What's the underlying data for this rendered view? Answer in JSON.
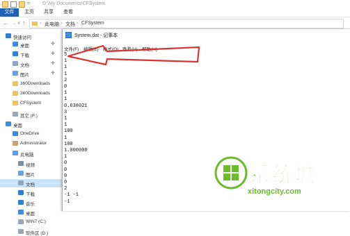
{
  "explorer": {
    "title_path": "D:\\My Documents\\CFSystem",
    "ribbon_tabs": [
      "文件",
      "主页",
      "共享",
      "查看"
    ],
    "breadcrumbs": [
      "此电脑",
      "文档",
      "CFSystem"
    ],
    "sidebar": [
      {
        "label": "快速访问",
        "icon": "star-icon",
        "color": "#2e7fd6",
        "pinned": false
      },
      {
        "label": "桌面",
        "icon": "desktop-icon",
        "color": "#3d8ee0",
        "pinned": true
      },
      {
        "label": "下载",
        "icon": "download-icon",
        "color": "#2e7fd6",
        "pinned": true
      },
      {
        "label": "文档",
        "icon": "document-icon",
        "color": "#8da6c4",
        "pinned": true
      },
      {
        "label": "图片",
        "icon": "picture-icon",
        "color": "#6ca1d8",
        "pinned": true
      },
      {
        "label": "360Downloads",
        "icon": "folder-icon",
        "color": "#f1c45a",
        "pinned": false
      },
      {
        "label": "360Downloads",
        "icon": "folder-icon",
        "color": "#f1c45a",
        "pinned": false
      },
      {
        "label": "CFSystem",
        "icon": "folder-icon",
        "color": "#f1c45a",
        "pinned": false
      },
      {
        "label": "其它 (F:)",
        "icon": "drive-icon",
        "color": "#9aa7b3",
        "pinned": false
      },
      {
        "label": "桌面",
        "icon": "desktop-icon",
        "color": "#3d8ee0",
        "pinned": false
      },
      {
        "label": "OneDrive",
        "icon": "cloud-icon",
        "color": "#3a8be0",
        "pinned": false
      },
      {
        "label": "Administrator",
        "icon": "user-icon",
        "color": "#c7a26c",
        "pinned": false
      },
      {
        "label": "此电脑",
        "icon": "pc-icon",
        "color": "#5aa0e6",
        "pinned": false
      },
      {
        "label": "视频",
        "icon": "video-icon",
        "color": "#7c8da0",
        "pinned": false
      },
      {
        "label": "图片",
        "icon": "picture-icon",
        "color": "#6ca1d8",
        "pinned": false
      },
      {
        "label": "文档",
        "icon": "document-icon",
        "color": "#8da6c4",
        "pinned": false,
        "selected": true
      },
      {
        "label": "下载",
        "icon": "download-icon",
        "color": "#2e7fd6",
        "pinned": false
      },
      {
        "label": "音乐",
        "icon": "music-icon",
        "color": "#2e7fd6",
        "pinned": false
      },
      {
        "label": "桌面",
        "icon": "desktop-icon",
        "color": "#3d8ee0",
        "pinned": false
      },
      {
        "label": "WIN7 (C:)",
        "icon": "drive-icon",
        "color": "#9aa7b3",
        "pinned": false
      },
      {
        "label": "软件区 (D:)",
        "icon": "drive-icon",
        "color": "#9aa7b3",
        "pinned": false
      }
    ]
  },
  "notepad": {
    "title": "System.dat - 记事本",
    "menu": [
      "文件(F)",
      "编辑(E)",
      "格式(O)",
      "查看(V)",
      "帮助(H)"
    ],
    "lines": [
      "5",
      "1",
      "1",
      "1",
      "2",
      "0",
      "1",
      "1",
      "0.638021",
      "3",
      "1",
      "1",
      "100",
      "1",
      "100",
      "1.000000",
      "1",
      "0",
      "0",
      "0",
      "0",
      "2",
      "-1 -1",
      "-1"
    ]
  },
  "annotation": {
    "arrow_color": "#d9322f"
  },
  "watermark": {
    "brand": "系统城",
    "domain": "xitongcity.com",
    "color": "#6dbb2b"
  }
}
